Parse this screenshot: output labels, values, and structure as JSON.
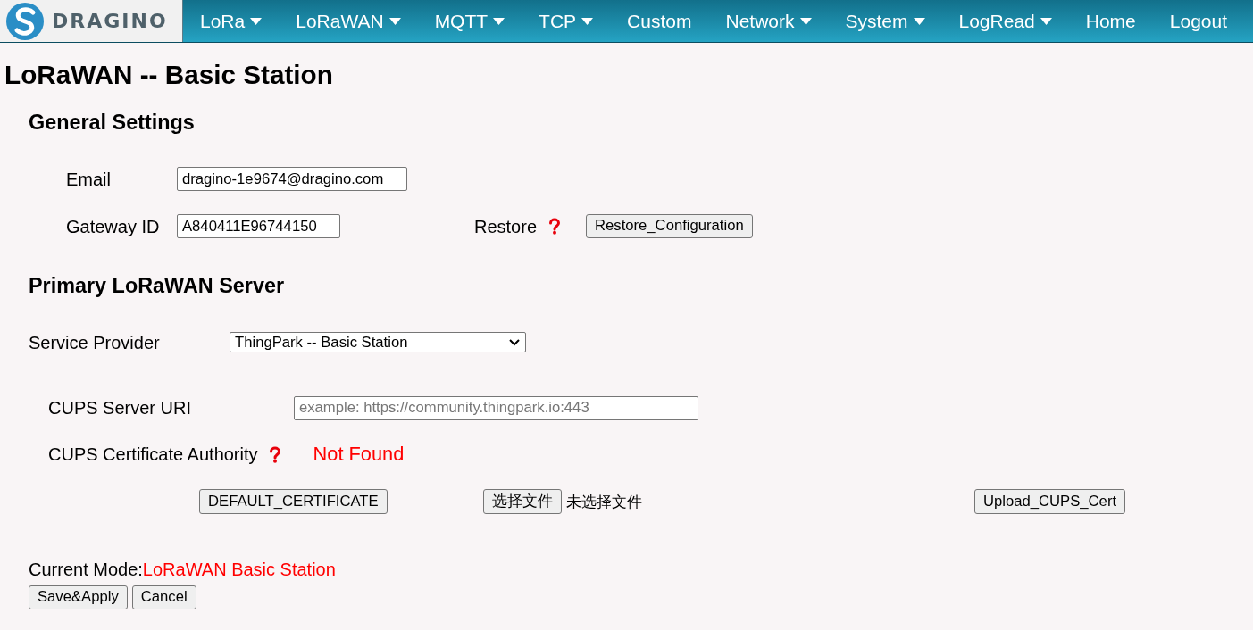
{
  "logo": {
    "text": "DRAGINO"
  },
  "nav": [
    {
      "label": "LoRa",
      "kind": "dropdown"
    },
    {
      "label": "LoRaWAN",
      "kind": "dropdown"
    },
    {
      "label": "MQTT",
      "kind": "dropdown"
    },
    {
      "label": "TCP",
      "kind": "dropdown"
    },
    {
      "label": "Custom",
      "kind": "link"
    },
    {
      "label": "Network",
      "kind": "dropdown"
    },
    {
      "label": "System",
      "kind": "dropdown"
    },
    {
      "label": "LogRead",
      "kind": "dropdown"
    },
    {
      "label": "Home",
      "kind": "link"
    },
    {
      "label": "Logout",
      "kind": "link"
    }
  ],
  "page_title": "LoRaWAN -- Basic Station",
  "general_settings": {
    "heading": "General Settings",
    "email": {
      "label": "Email",
      "value": "dragino-1e9674@dragino.com"
    },
    "gateway_id": {
      "label": "Gateway ID",
      "value": "A840411E96744150"
    },
    "restore": {
      "label": "Restore",
      "button": "Restore_Configuration"
    }
  },
  "primary_server": {
    "heading": "Primary LoRaWAN Server",
    "service_provider": {
      "label": "Service Provider",
      "value": "ThingPark -- Basic Station"
    },
    "cups_server_uri": {
      "label": "CUPS Server URI",
      "placeholder": "example: https://community.thingpark.io:443"
    },
    "cups_certificate_authority": {
      "label": "CUPS Certificate Authority",
      "status": "Not Found"
    },
    "default_certificate_button": "DEFAULT_CERTIFICATE",
    "file_picker": {
      "button": "选择文件",
      "status": "未选择文件"
    },
    "upload_button": "Upload_CUPS_Cert"
  },
  "current_mode": {
    "label": "Current Mode:",
    "value": "LoRaWAN Basic Station"
  },
  "buttons": [
    "Save&Apply",
    "Cancel"
  ]
}
